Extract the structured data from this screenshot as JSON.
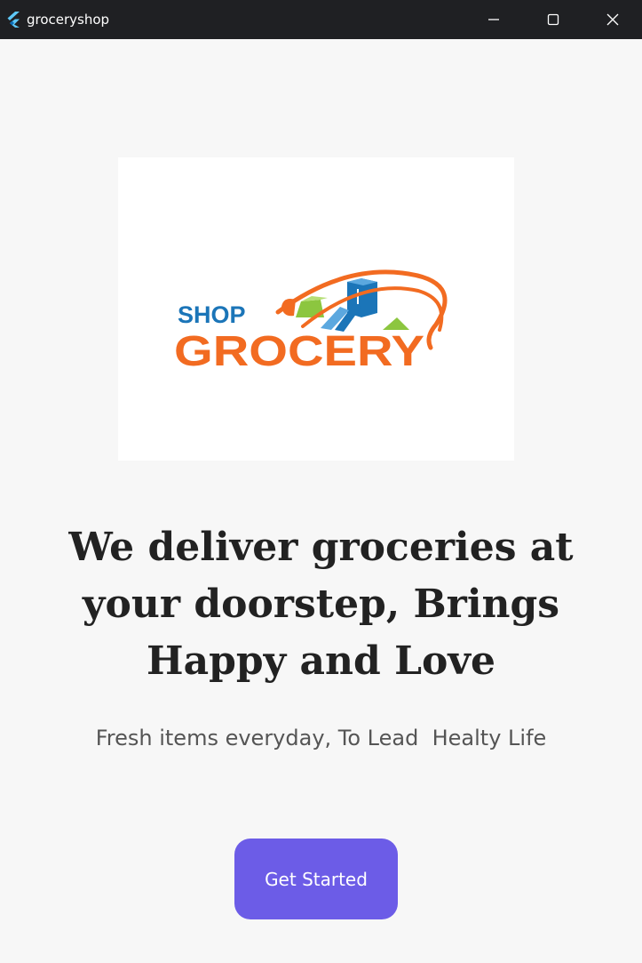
{
  "window": {
    "title": "groceryshop",
    "icon": "flutter-icon",
    "controls": [
      "minimize-icon",
      "maximize-icon",
      "close-icon"
    ]
  },
  "logo": {
    "line1": "SHOP",
    "line2": "GROCERY",
    "colors": {
      "shop_text": "#1b75b8",
      "grocery_text": "#f26b21",
      "swoosh": "#f26b21"
    }
  },
  "hero": {
    "headline": "We deliver groceries at your doorstep, Brings Happy and Love",
    "subtitle": "Fresh items everyday, To Lead  Healty Life"
  },
  "cta": {
    "label": "Get Started",
    "color": "#6c5ce7"
  }
}
